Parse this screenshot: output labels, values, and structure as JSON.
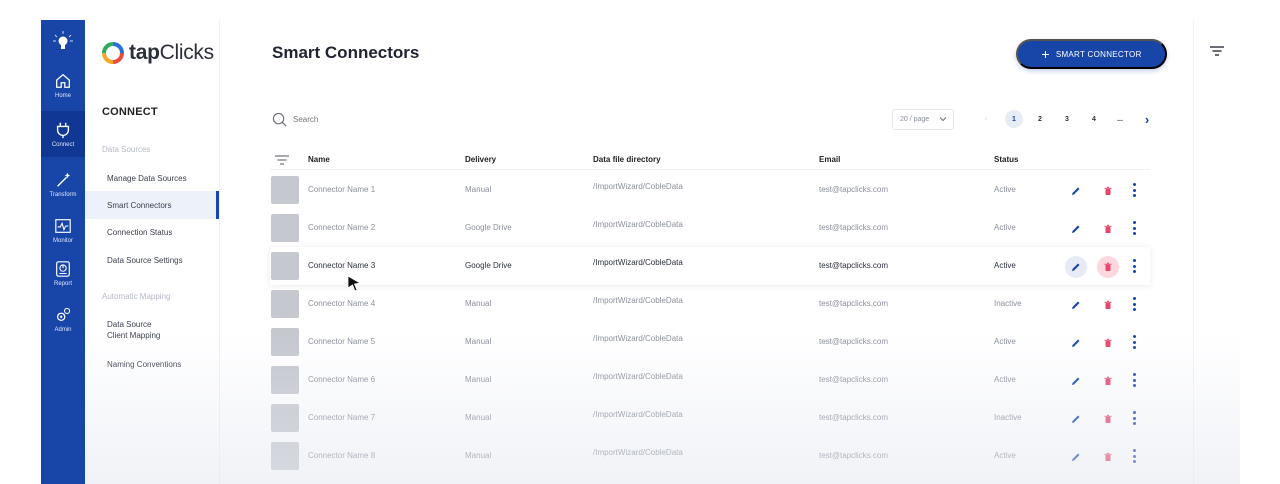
{
  "rail": {
    "items": [
      {
        "label": "Home",
        "icon": "home-icon"
      },
      {
        "label": "Connect",
        "icon": "plug-icon"
      },
      {
        "label": "Transform",
        "icon": "wand-icon"
      },
      {
        "label": "Monitor",
        "icon": "monitor-icon"
      },
      {
        "label": "Report",
        "icon": "report-icon"
      },
      {
        "label": "Admin",
        "icon": "gears-icon"
      }
    ]
  },
  "brand": {
    "name_bold": "tap",
    "name_rest": "Clicks"
  },
  "sidebar": {
    "heading": "CONNECT",
    "category_1": "Data Sources",
    "links_1": [
      "Manage Data Sources",
      "Smart Connectors",
      "Connection Status",
      "Data Source Settings"
    ],
    "category_2": "Automatic Mapping",
    "links_2": [
      "Data Source\nClient Mapping",
      "Naming Conventions"
    ]
  },
  "header": {
    "title": "Smart Connectors",
    "cta_label": "SMART CONNECTOR"
  },
  "toolbar": {
    "search_placeholder": "Search",
    "page_size": "20 / page",
    "pages": [
      "1",
      "2",
      "3",
      "4",
      "..."
    ]
  },
  "table": {
    "columns": [
      "Name",
      "Delivery",
      "Data file directory",
      "Email",
      "Status"
    ],
    "rows": [
      {
        "name": "Connector Name 1",
        "delivery": "Manual",
        "dir": "/ImportWizard/CobleData",
        "email": "test@tapclicks.com",
        "status": "Active"
      },
      {
        "name": "Connector Name 2",
        "delivery": "Google Drive",
        "dir": "/ImportWizard/CobleData",
        "email": "test@tapclicks.com",
        "status": "Active"
      },
      {
        "name": "Connector Name 3",
        "delivery": "Google Drive",
        "dir": "/ImportWizard/CobleData",
        "email": "test@tapclicks.com",
        "status": "Active"
      },
      {
        "name": "Connector Name 4",
        "delivery": "Manual",
        "dir": "/ImportWizard/CobleData",
        "email": "test@tapclicks.com",
        "status": "Inactive"
      },
      {
        "name": "Connector Name 5",
        "delivery": "Manual",
        "dir": "/ImportWizard/CobleData",
        "email": "test@tapclicks.com",
        "status": "Active"
      },
      {
        "name": "Connector Name 6",
        "delivery": "Manual",
        "dir": "/ImportWizard/CobleData",
        "email": "test@tapclicks.com",
        "status": "Active"
      },
      {
        "name": "Connector Name 7",
        "delivery": "Manual",
        "dir": "/ImportWizard/CobleData",
        "email": "test@tapclicks.com",
        "status": "Inactive"
      },
      {
        "name": "Connector Name 8",
        "delivery": "Manual",
        "dir": "/ImportWizard/CobleData",
        "email": "test@tapclicks.com",
        "status": "Active"
      }
    ]
  },
  "colors": {
    "primary": "#1745a8",
    "delete": "#e8456b",
    "muted": "#8a8f99"
  }
}
